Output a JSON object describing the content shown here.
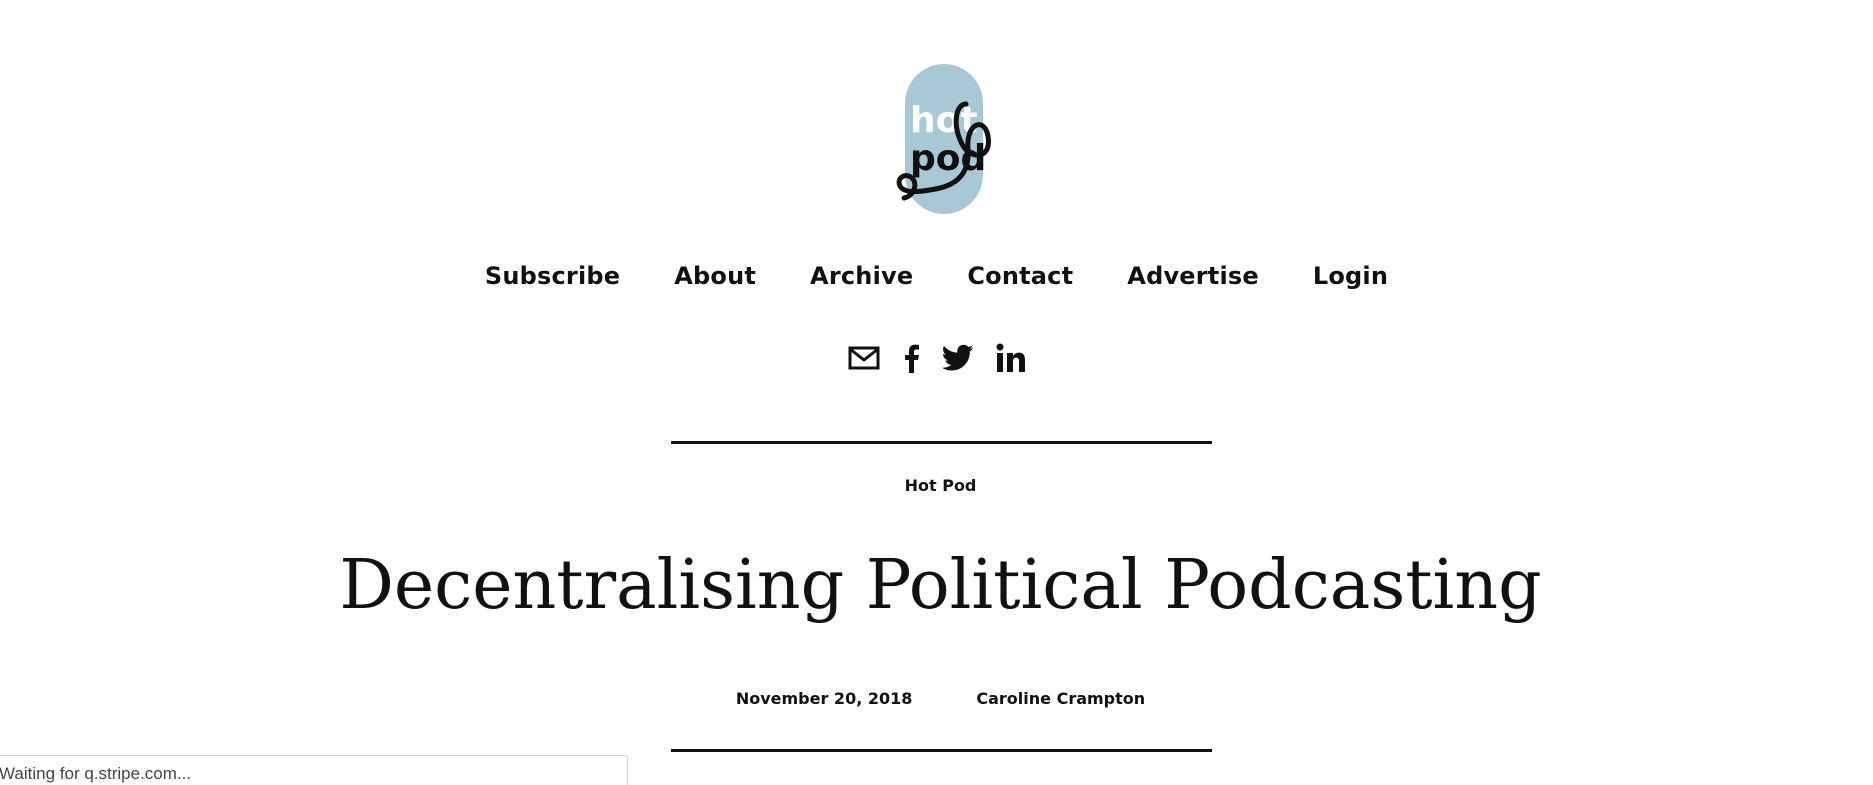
{
  "brand": {
    "logo_lettering": "hot pod",
    "logo_bg_color": "#a9c8d6"
  },
  "nav": {
    "items": [
      {
        "label": "Subscribe"
      },
      {
        "label": "About"
      },
      {
        "label": "Archive"
      },
      {
        "label": "Contact"
      },
      {
        "label": "Advertise"
      },
      {
        "label": "Login"
      }
    ]
  },
  "social": {
    "icons": [
      "email-icon",
      "facebook-icon",
      "twitter-icon",
      "linkedin-icon"
    ]
  },
  "post": {
    "section": "Hot Pod",
    "title": "Decentralising Political Podcasting",
    "date": "November 20, 2018",
    "author": "Caroline Crampton"
  },
  "browser": {
    "status_text": "Waiting for q.stripe.com..."
  }
}
